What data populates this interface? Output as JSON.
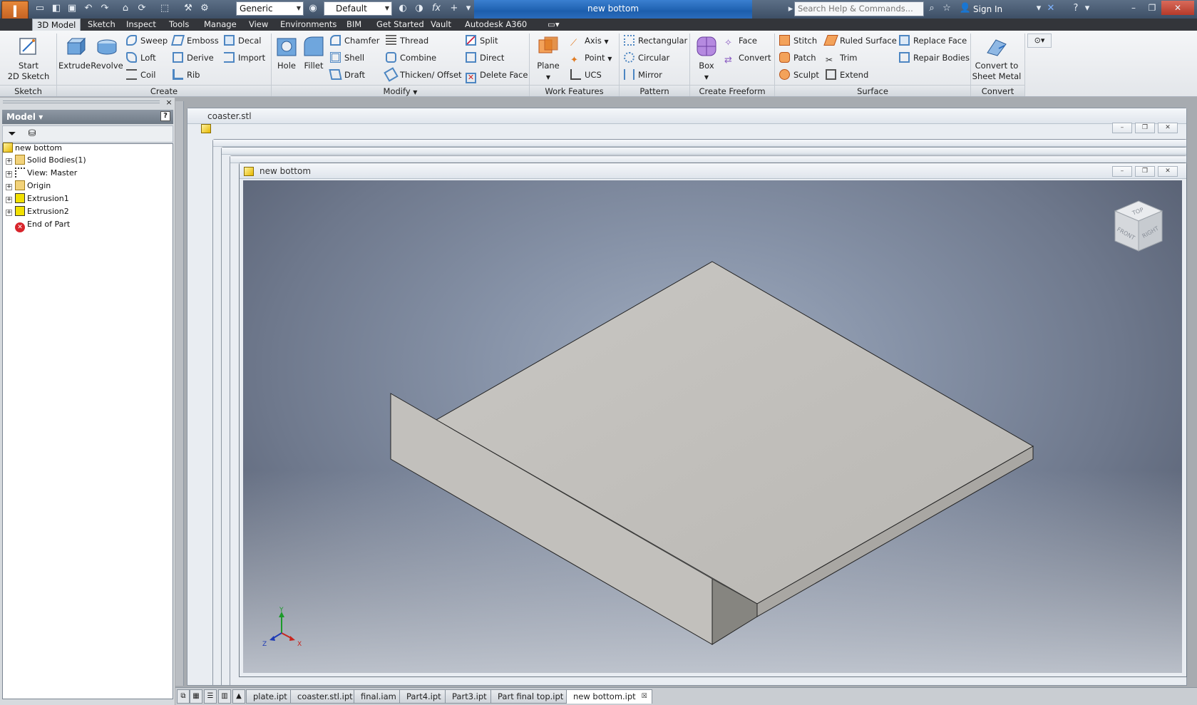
{
  "title_bar": {
    "document_title": "new bottom",
    "material_combo": "Generic",
    "appearance_combo": "Default",
    "search_placeholder": "Search Help & Commands...",
    "sign_in": "Sign In"
  },
  "menu_tabs": [
    "3D Model",
    "Sketch",
    "Inspect",
    "Tools",
    "Manage",
    "View",
    "Environments",
    "BIM",
    "Get Started",
    "Vault",
    "Autodesk A360"
  ],
  "ribbon": {
    "sketch": {
      "start_line1": "Start",
      "start_line2": "2D Sketch",
      "panel": "Sketch"
    },
    "create": {
      "extrude": "Extrude",
      "revolve": "Revolve",
      "sweep": "Sweep",
      "loft": "Loft",
      "coil": "Coil",
      "emboss": "Emboss",
      "derive": "Derive",
      "rib": "Rib",
      "decal": "Decal",
      "import": "Import",
      "panel": "Create"
    },
    "modify": {
      "hole": "Hole",
      "fillet": "Fillet",
      "chamfer": "Chamfer",
      "shell": "Shell",
      "draft": "Draft",
      "thread": "Thread",
      "combine": "Combine",
      "thicken": "Thicken/ Offset",
      "split": "Split",
      "direct": "Direct",
      "delete_face": "Delete Face",
      "panel": "Modify"
    },
    "work_features": {
      "plane": "Plane",
      "axis": "Axis",
      "point": "Point",
      "ucs": "UCS",
      "panel": "Work Features"
    },
    "pattern": {
      "rectangular": "Rectangular",
      "circular": "Circular",
      "mirror": "Mirror",
      "panel": "Pattern"
    },
    "freeform": {
      "box": "Box",
      "face": "Face",
      "convert": "Convert",
      "panel": "Create Freeform"
    },
    "surface": {
      "stitch": "Stitch",
      "patch": "Patch",
      "sculpt": "Sculpt",
      "ruled": "Ruled Surface",
      "trim": "Trim",
      "extend": "Extend",
      "replace_face": "Replace Face",
      "repair_bodies": "Repair Bodies",
      "panel": "Surface"
    },
    "convert": {
      "line1": "Convert to",
      "line2": "Sheet Metal",
      "panel": "Convert"
    }
  },
  "browser": {
    "header": "Model",
    "items": [
      "new bottom",
      "Solid Bodies(1)",
      "View: Master",
      "Origin",
      "Extrusion1",
      "Extrusion2",
      "End of Part"
    ]
  },
  "windows": {
    "back_title": "coaster.stl",
    "front_title": "new bottom"
  },
  "viewcube": {
    "top": "TOP",
    "front": "FRONT",
    "right": "RIGHT"
  },
  "triad": {
    "x": "X",
    "y": "Y",
    "z": "Z"
  },
  "doc_tabs": [
    "plate.ipt",
    "coaster.stl.ipt",
    "final.iam",
    "Part4.ipt",
    "Part3.ipt",
    "Part final top.ipt",
    "new bottom.ipt"
  ]
}
